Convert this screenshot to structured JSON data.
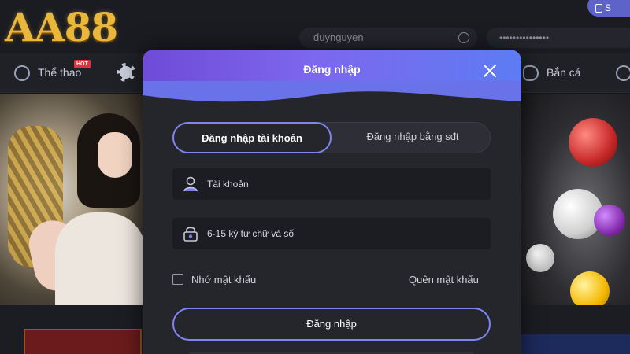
{
  "header": {
    "logo_text": "AA88",
    "username_value": "duynguyen",
    "password_value": "•••••••••••••••",
    "register_label": "S"
  },
  "nav": {
    "items": [
      {
        "label": "Thể thao",
        "icon": "soccer-ball-icon",
        "badge": "HOT"
      },
      {
        "label": "Bắn cá",
        "icon": "fish-icon"
      }
    ]
  },
  "modal": {
    "title": "Đăng nhập",
    "tabs": [
      {
        "label": "Đăng nhập tài khoản",
        "active": true
      },
      {
        "label": "Đăng nhập bằng sđt",
        "active": false
      }
    ],
    "account_field": {
      "placeholder": "Tài khoản",
      "icon": "user-icon"
    },
    "password_field": {
      "placeholder": "6-15 ký tự chữ và số",
      "icon": "lock-icon"
    },
    "remember_label": "Nhớ mật khẩu",
    "forgot_label": "Quên mật khẩu",
    "submit_label": "Đăng nhập"
  },
  "colors": {
    "accent": "#7e84f0",
    "header_gradient_start": "#6f4bd8",
    "header_gradient_end": "#5d7cf3",
    "logo_gold": "#e9b73a"
  }
}
